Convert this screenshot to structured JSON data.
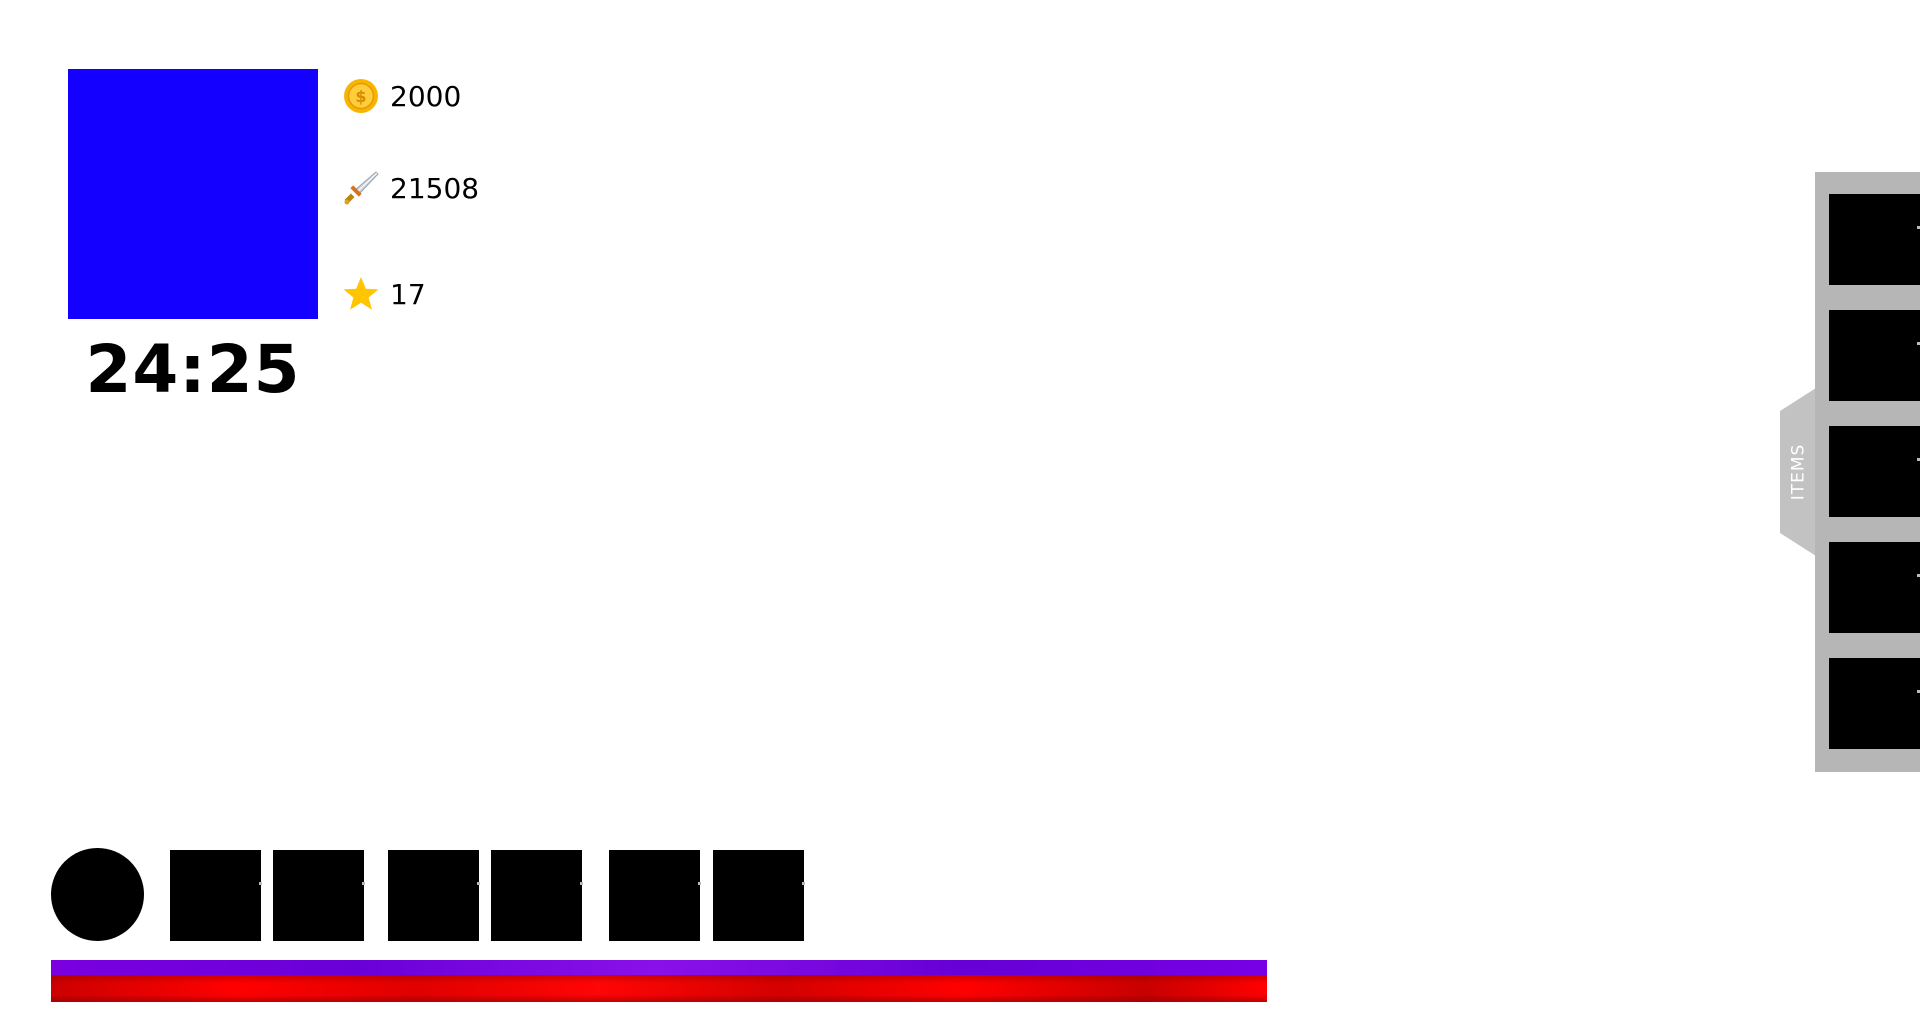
{
  "player": {
    "portrait_color": "#1400ff",
    "timer": "24:25"
  },
  "stats": {
    "gold": {
      "icon": "coin-icon",
      "value": "2000"
    },
    "kills": {
      "icon": "sword-icon",
      "value": "21508"
    },
    "level": {
      "icon": "star-icon",
      "value": "17"
    }
  },
  "hotbar": {
    "ability_icon": "circle-ability",
    "slot_count": 6
  },
  "bars": {
    "mana": {
      "fill": 1.0,
      "color": "#7000e0"
    },
    "health": {
      "fill": 1.0,
      "color": "#ff0000"
    }
  },
  "items_panel": {
    "tab_label": "ITEMS",
    "slot_count": 5,
    "background": "#b6b6b6"
  }
}
